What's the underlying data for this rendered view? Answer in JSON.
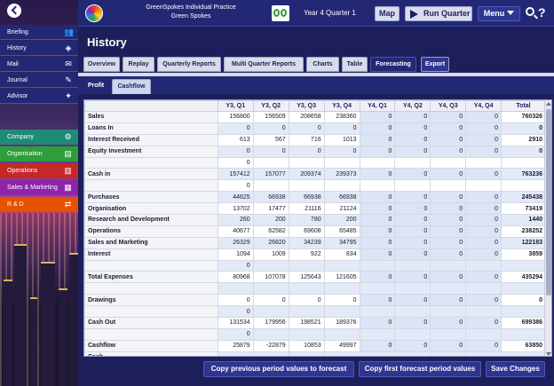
{
  "header": {
    "practice_title": "GreenSpokes Individual Practice",
    "company_name": "Green Spokes",
    "period": "Year 4 Quarter 1",
    "map_label": "Map",
    "run_quarter_label": "Run Quarter",
    "menu_label": "Menu",
    "help_label": "?"
  },
  "sidebar": {
    "nav": [
      {
        "label": "Briefing",
        "icon": "people-icon"
      },
      {
        "label": "History",
        "icon": "history-icon"
      },
      {
        "label": "Mail",
        "icon": "mail-icon"
      },
      {
        "label": "Journal",
        "icon": "pencil-icon"
      },
      {
        "label": "Advisor",
        "icon": "lightbulb-icon"
      }
    ],
    "departments": [
      {
        "label": "Company",
        "icon": "gears-icon",
        "color": "#1f8a78"
      },
      {
        "label": "Organisation",
        "icon": "clipboard-icon",
        "color": "#2e9d3a"
      },
      {
        "label": "Operations",
        "icon": "factory-icon",
        "color": "#c62828"
      },
      {
        "label": "Sales & Marketing",
        "icon": "chart-icon",
        "color": "#8e24aa"
      },
      {
        "label": "R & D",
        "icon": "flask-icon",
        "color": "#e65100"
      }
    ]
  },
  "page": {
    "title": "History",
    "tabs": [
      "Overview",
      "Replay",
      "Quarterly Reports",
      "Multi Quarter Reports",
      "Charts",
      "Table",
      "Forecasting",
      "Export"
    ],
    "active_tab": "Forecasting",
    "subtabs": [
      "Profit",
      "Cashflow"
    ],
    "active_subtab": "Cashflow"
  },
  "table": {
    "columns": [
      "",
      "Y3, Q1",
      "Y3, Q2",
      "Y3, Q3",
      "Y3, Q4",
      "Y4, Q1",
      "Y4, Q2",
      "Y4, Q3",
      "Y4, Q4",
      "Total"
    ],
    "rows": [
      {
        "label": "Sales",
        "values": [
          "156800",
          "156509",
          "208658",
          "238360",
          "0",
          "0",
          "0",
          "0",
          "760326"
        ],
        "hl": false
      },
      {
        "label": "Loans In",
        "values": [
          "0",
          "0",
          "0",
          "0",
          "0",
          "0",
          "0",
          "0",
          "0"
        ],
        "hl": true
      },
      {
        "label": "Interest Received",
        "values": [
          "613",
          "567",
          "716",
          "1013",
          "0",
          "0",
          "0",
          "0",
          "2910"
        ],
        "hl": false
      },
      {
        "label": "Equity Investment",
        "values": [
          "0",
          "0",
          "0",
          "0",
          "0",
          "0",
          "0",
          "0",
          "0"
        ],
        "hl": true
      },
      {
        "label": "",
        "values": [
          "0",
          "",
          "",
          "",
          "",
          "",
          "",
          "",
          ""
        ],
        "hl": false
      },
      {
        "label": "Cash in",
        "values": [
          "157412",
          "157077",
          "209374",
          "239373",
          "0",
          "0",
          "0",
          "0",
          "763236"
        ],
        "hl": true
      },
      {
        "label": "",
        "values": [
          "0",
          "",
          "",
          "",
          "",
          "",
          "",
          "",
          ""
        ],
        "hl": false
      },
      {
        "label": "Purchases",
        "values": [
          "44625",
          "66938",
          "66938",
          "66938",
          "0",
          "0",
          "0",
          "0",
          "245438"
        ],
        "hl": true
      },
      {
        "label": "Organisation",
        "values": [
          "13702",
          "17477",
          "21116",
          "21124",
          "0",
          "0",
          "0",
          "0",
          "73419"
        ],
        "hl": false
      },
      {
        "label": "Research and Development",
        "values": [
          "260",
          "200",
          "780",
          "200",
          "0",
          "0",
          "0",
          "0",
          "1440"
        ],
        "hl": true
      },
      {
        "label": "Operations",
        "values": [
          "40677",
          "62582",
          "69608",
          "65485",
          "0",
          "0",
          "0",
          "0",
          "238252"
        ],
        "hl": false
      },
      {
        "label": "Sales and Marketing",
        "values": [
          "26329",
          "26820",
          "34239",
          "34795",
          "0",
          "0",
          "0",
          "0",
          "122183"
        ],
        "hl": true
      },
      {
        "label": "Interest",
        "values": [
          "1094",
          "1009",
          "922",
          "834",
          "0",
          "0",
          "0",
          "0",
          "3859"
        ],
        "hl": false
      },
      {
        "label": "",
        "values": [
          "0",
          "",
          "",
          "",
          "",
          "",
          "",
          "",
          ""
        ],
        "hl": true
      },
      {
        "label": "Total Expenses",
        "values": [
          "80968",
          "107078",
          "125643",
          "121605",
          "0",
          "0",
          "0",
          "0",
          "435294"
        ],
        "hl": false
      },
      {
        "label": "",
        "values": [
          "",
          "",
          "",
          "",
          "",
          "",
          "",
          "",
          ""
        ],
        "hl": true
      },
      {
        "label": "Drawings",
        "values": [
          "0",
          "0",
          "0",
          "0",
          "0",
          "0",
          "0",
          "0",
          "0"
        ],
        "hl": false
      },
      {
        "label": "",
        "values": [
          "0",
          "",
          "",
          "",
          "",
          "",
          "",
          "",
          ""
        ],
        "hl": true
      },
      {
        "label": "Cash Out",
        "values": [
          "131534",
          "179956",
          "198521",
          "189376",
          "0",
          "0",
          "0",
          "0",
          "699386"
        ],
        "hl": false
      },
      {
        "label": "",
        "values": [
          "0",
          "",
          "",
          "",
          "",
          "",
          "",
          "",
          ""
        ],
        "hl": true
      },
      {
        "label": "Cashflow",
        "values": [
          "25879",
          "-22879",
          "10853",
          "49997",
          "0",
          "0",
          "0",
          "0",
          "63850"
        ],
        "hl": false
      },
      {
        "label": "Cash",
        "values": [
          "",
          "",
          "",
          "",
          "",
          "",
          "",
          "",
          ""
        ],
        "hl": true
      }
    ]
  },
  "actions": {
    "copy_previous": "Copy previous period values to forecast",
    "copy_first": "Copy first forecast period values",
    "save": "Save Changes"
  }
}
